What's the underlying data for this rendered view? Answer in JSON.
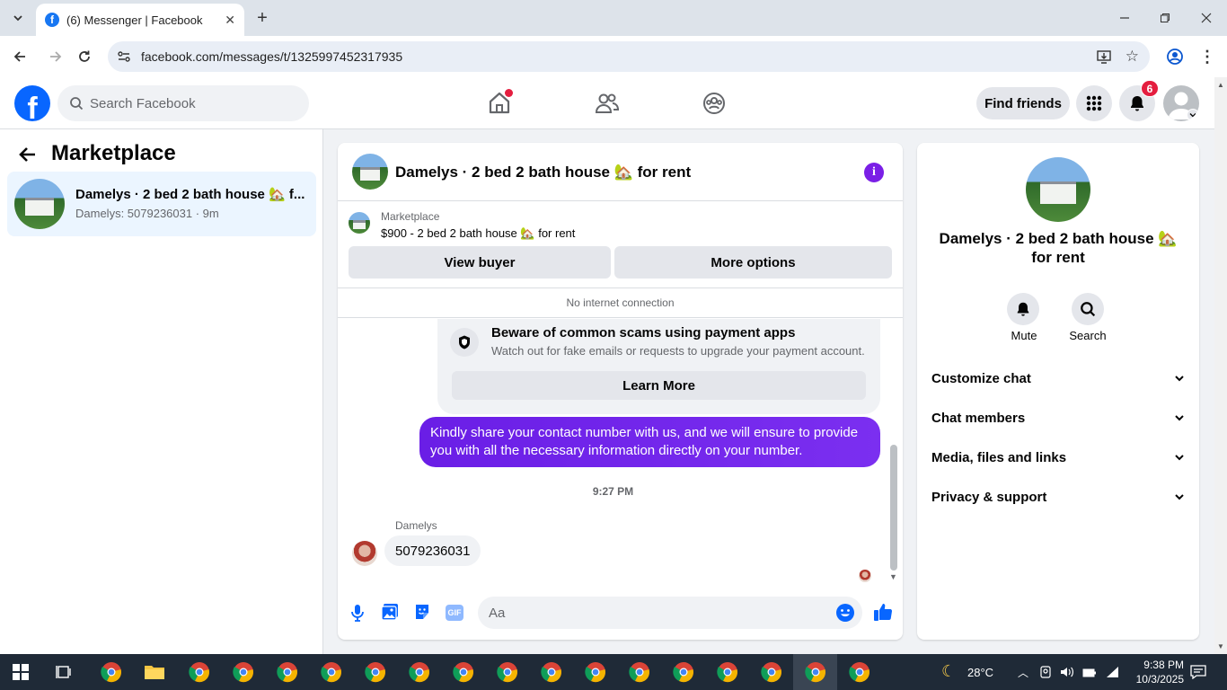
{
  "browser": {
    "tab_title": "(6) Messenger | Facebook",
    "url": "facebook.com/messages/t/1325997452317935"
  },
  "header": {
    "search_placeholder": "Search Facebook",
    "find_friends": "Find friends",
    "notification_count": "6"
  },
  "sidebar": {
    "title": "Marketplace",
    "conversation": {
      "name": "Damelys · 2 bed 2 bath house 🏡 f...",
      "preview": "Damelys: 5079236031 · 9m"
    }
  },
  "chat": {
    "title": "Damelys · 2 bed 2 bath house 🏡 for rent",
    "listing_label": "Marketplace",
    "listing_detail": "$900 - 2 bed 2 bath house 🏡 for rent",
    "view_buyer": "View buyer",
    "more_options": "More options",
    "status": "No internet connection",
    "scam_title": "Beware of common scams using payment apps",
    "scam_text": "Watch out for fake emails or requests to upgrade your payment account.",
    "learn_more": "Learn More",
    "sent_message": "Kindly share your contact number with us, and we will ensure to provide you with all the necessary information directly on your number.",
    "timestamp": "9:27 PM",
    "sender_name": "Damelys",
    "received_message": "5079236031",
    "input_placeholder": "Aa"
  },
  "details": {
    "name": "Damelys · 2 bed 2 bath house 🏡 for rent",
    "mute": "Mute",
    "search": "Search",
    "sections": [
      "Customize chat",
      "Chat members",
      "Media, files and links",
      "Privacy & support"
    ]
  },
  "taskbar": {
    "weather": "28°C",
    "time": "9:38 PM",
    "date": "10/3/2025"
  },
  "colors": {
    "accent": "#0866ff",
    "messenger_purple": "#7a1fe6",
    "notification_red": "#e41e3f"
  }
}
